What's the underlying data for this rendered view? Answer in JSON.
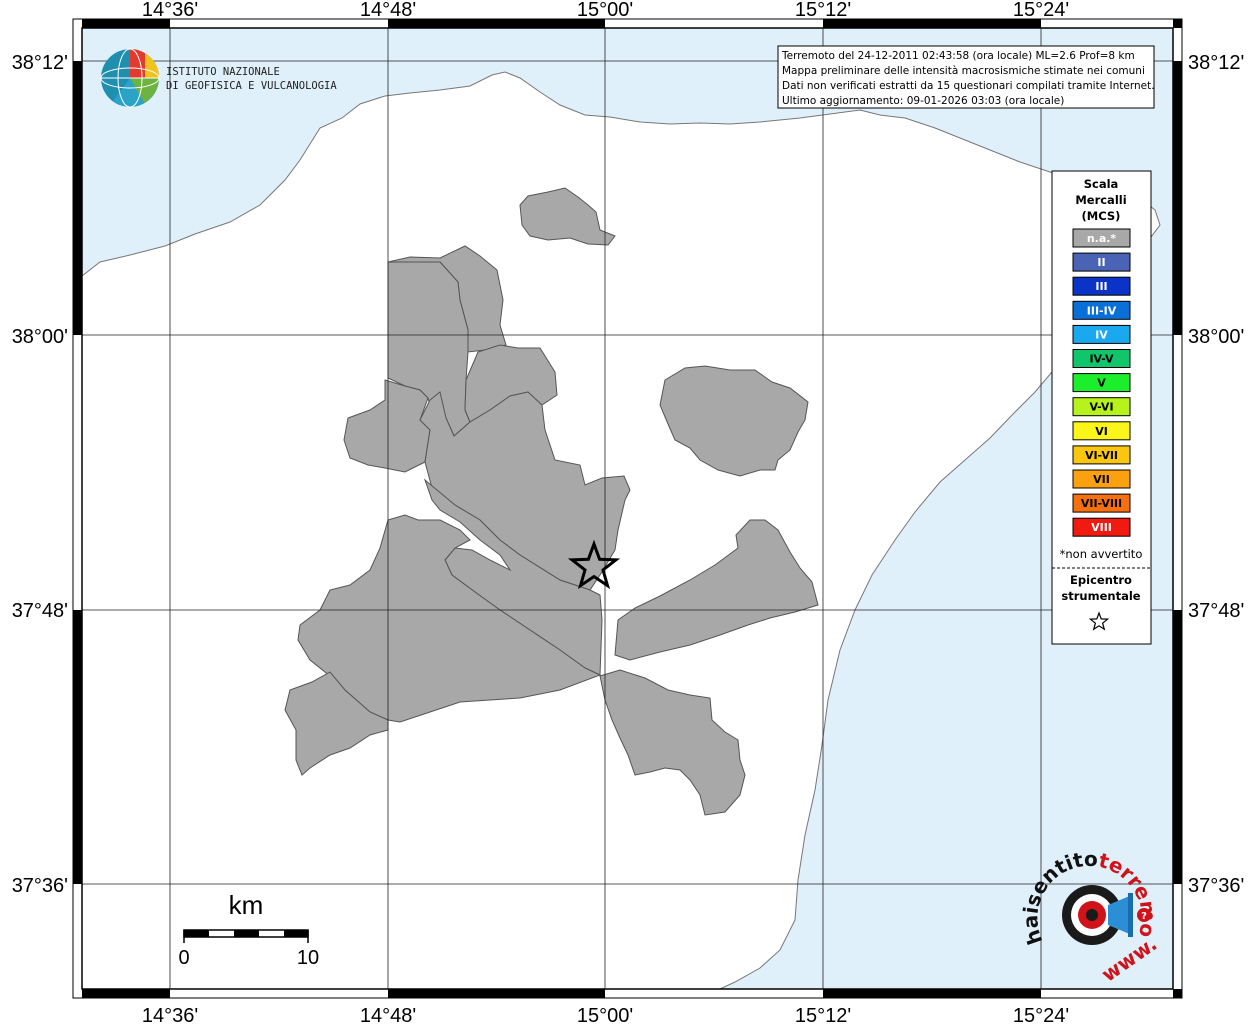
{
  "map": {
    "lon_labels": [
      "14°36'",
      "14°48'",
      "15°00'",
      "15°12'",
      "15°24'"
    ],
    "lat_labels": [
      "38°12'",
      "38°00'",
      "37°48'",
      "37°36'"
    ],
    "colors": {
      "sea": "#e0f0fb",
      "land": "#ffffff",
      "not_felt": "#a8a8a8",
      "border": "#555555"
    }
  },
  "info_box": {
    "line1": "Terremoto del 24-12-2011 02:43:58 (ora locale) ML=2.6 Prof=8 km",
    "line2": "Mappa preliminare delle intensità macrosismiche stimate nei comuni",
    "line3": "Dati non verificati estratti da 15 questionari compilati tramite Internet.",
    "line4": "Ultimo aggiornamento: 09-01-2026 03:03 (ora locale)"
  },
  "logo": {
    "line1": "ISTITUTO NAZIONALE",
    "line2": "DI GEOFISICA E VULCANOLOGIA",
    "icon": "ingv-globe-icon"
  },
  "legend": {
    "title": [
      "Scala",
      "Mercalli",
      "(MCS)"
    ],
    "items": [
      {
        "label": "n.a.*",
        "color": "#a8a8a8",
        "text_color": "#ffffff"
      },
      {
        "label": "II",
        "color": "#4a63b5",
        "text_color": "#ffffff"
      },
      {
        "label": "III",
        "color": "#0b33c8",
        "text_color": "#ffffff"
      },
      {
        "label": "III-IV",
        "color": "#0b6fd8",
        "text_color": "#ffffff"
      },
      {
        "label": "IV",
        "color": "#1aa9ee",
        "text_color": "#ffffff"
      },
      {
        "label": "IV-V",
        "color": "#11c66a",
        "text_color": "#000000"
      },
      {
        "label": "V",
        "color": "#1bef2c",
        "text_color": "#000000"
      },
      {
        "label": "V-VI",
        "color": "#b6f21c",
        "text_color": "#000000"
      },
      {
        "label": "VI",
        "color": "#fbf51a",
        "text_color": "#000000"
      },
      {
        "label": "VI-VII",
        "color": "#fbc60f",
        "text_color": "#000000"
      },
      {
        "label": "VII",
        "color": "#fba00f",
        "text_color": "#000000"
      },
      {
        "label": "VII-VIII",
        "color": "#f7700f",
        "text_color": "#000000"
      },
      {
        "label": "VIII",
        "color": "#f01a10",
        "text_color": "#ffffff"
      }
    ],
    "note": "*non avvertito",
    "epicenter_title": [
      "Epicentro",
      "strumentale"
    ],
    "epicenter_icon": "star-icon"
  },
  "scale_bar": {
    "unit": "km",
    "min": "0",
    "max": "10"
  },
  "badge": {
    "text_main": "haisentito",
    "text_domain": "terremoto.it",
    "text_prefix": "www.",
    "icon": "megaphone-icon"
  }
}
